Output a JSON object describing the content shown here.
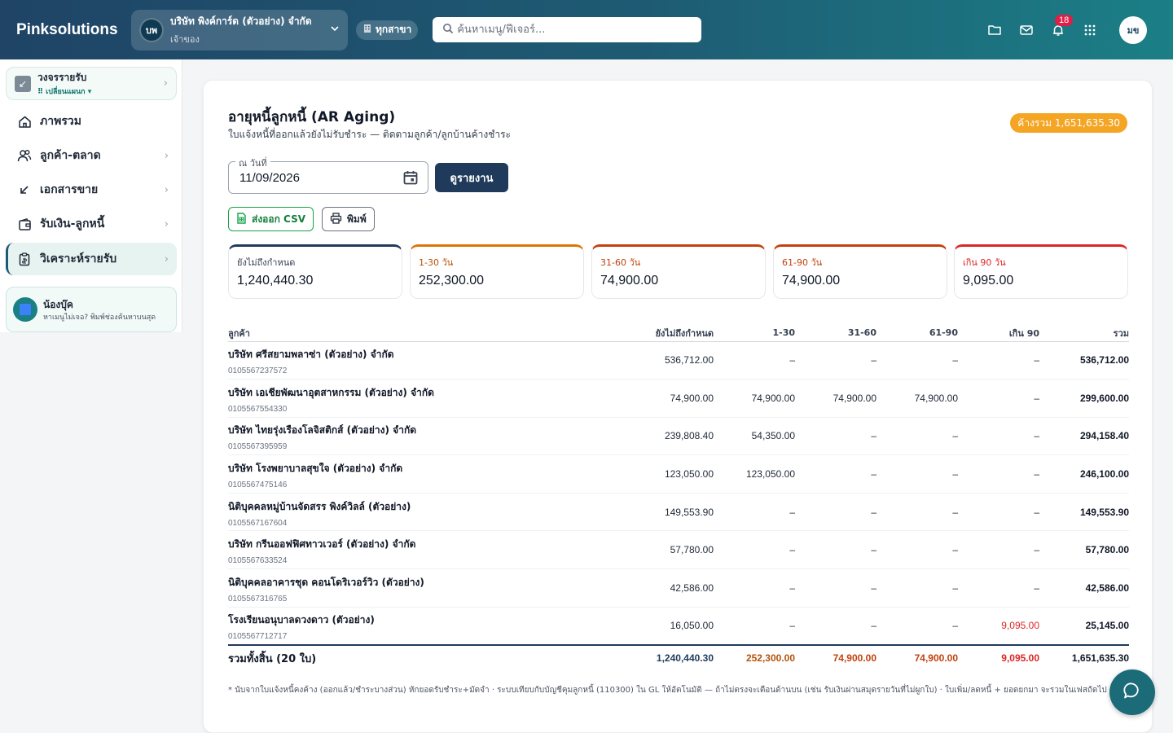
{
  "header": {
    "brand": "Pinksolutions",
    "company": {
      "initials": "บพ",
      "name": "บริษัท พิงค์การ์ด (ตัวอย่าง) จำกัด",
      "role": "เจ้าของ"
    },
    "branch_label": "ทุกสาขา",
    "search_placeholder": "ค้นหาเมนู/ฟีเจอร์...",
    "notification_count": "18",
    "user_initials": "มข"
  },
  "sidebar": {
    "ledger": {
      "title": "วงจรรายรับ",
      "subtitle": "⠿ เปลี่ยนแผนก ▾"
    },
    "items": [
      {
        "label": "ภาพรวม",
        "icon": "home-icon",
        "has_chevron": false
      },
      {
        "label": "ลูกค้า-ตลาด",
        "icon": "users-icon",
        "has_chevron": true
      },
      {
        "label": "เอกสารขาย",
        "icon": "arrow-down-left-icon",
        "has_chevron": true
      },
      {
        "label": "รับเงิน-ลูกหนี้",
        "icon": "wallet-icon",
        "has_chevron": true
      },
      {
        "label": "วิเคราะห์รายรับ",
        "icon": "report-icon",
        "has_chevron": true,
        "active": true
      }
    ],
    "helper": {
      "title": "น้องบุ๊ค",
      "text": "หาเมนูไม่เจอ? พิมพ์ช่องค้นหาบนสุด"
    }
  },
  "report": {
    "title": "อายุหนี้ลูกหนี้ (AR Aging)",
    "subtitle": "ใบแจ้งหนี้ที่ออกแล้วยังไม่รับชำระ — ติดตามลูกค้า/ลูกบ้านค้างชำระ",
    "total_pill": "ค้างรวม 1,651,635.30",
    "date_label": "ณ วันที่",
    "date_value": "11/09/2026",
    "run_button": "ดูรายงาน",
    "export_csv": "ส่งออก CSV",
    "print": "พิมพ์",
    "buckets": [
      {
        "label": "ยังไม่ถึงกำหนด",
        "value": "1,240,440.30",
        "color": "#1f3a5a",
        "label_color": "#374151"
      },
      {
        "label": "1-30 วัน",
        "value": "252,300.00",
        "color": "#d97706",
        "label_color": "#b45309"
      },
      {
        "label": "31-60 วัน",
        "value": "74,900.00",
        "color": "#c2410c",
        "label_color": "#c2410c"
      },
      {
        "label": "61-90 วัน",
        "value": "74,900.00",
        "color": "#c2410c",
        "label_color": "#c2410c"
      },
      {
        "label": "เกิน 90 วัน",
        "value": "9,095.00",
        "color": "#dc2626",
        "label_color": "#dc2626"
      }
    ],
    "columns": [
      "ลูกค้า",
      "ยังไม่ถึงกำหนด",
      "1-30",
      "31-60",
      "61-90",
      "เกิน 90",
      "รวม"
    ],
    "rows": [
      {
        "name": "บริษัท ศรีสยามพลาซ่า (ตัวอย่าง) จำกัด",
        "tax_id": "0105567237572",
        "current": "536,712.00",
        "d30": "–",
        "d60": "–",
        "d90": "–",
        "over90": "–",
        "total": "536,712.00"
      },
      {
        "name": "บริษัท เอเชียพัฒนาอุตสาหกรรม (ตัวอย่าง) จำกัด",
        "tax_id": "0105567554330",
        "current": "74,900.00",
        "d30": "74,900.00",
        "d60": "74,900.00",
        "d90": "74,900.00",
        "over90": "–",
        "total": "299,600.00"
      },
      {
        "name": "บริษัท ไทยรุ่งเรืองโลจิสติกส์ (ตัวอย่าง) จำกัด",
        "tax_id": "0105567395959",
        "current": "239,808.40",
        "d30": "54,350.00",
        "d60": "–",
        "d90": "–",
        "over90": "–",
        "total": "294,158.40"
      },
      {
        "name": "บริษัท โรงพยาบาลสุขใจ (ตัวอย่าง) จำกัด",
        "tax_id": "0105567475146",
        "current": "123,050.00",
        "d30": "123,050.00",
        "d60": "–",
        "d90": "–",
        "over90": "–",
        "total": "246,100.00"
      },
      {
        "name": "นิติบุคคลหมู่บ้านจัดสรร พิงค์วิลล์ (ตัวอย่าง)",
        "tax_id": "0105567167604",
        "current": "149,553.90",
        "d30": "–",
        "d60": "–",
        "d90": "–",
        "over90": "–",
        "total": "149,553.90"
      },
      {
        "name": "บริษัท กรีนออฟฟิศทาวเวอร์ (ตัวอย่าง) จำกัด",
        "tax_id": "0105567633524",
        "current": "57,780.00",
        "d30": "–",
        "d60": "–",
        "d90": "–",
        "over90": "–",
        "total": "57,780.00"
      },
      {
        "name": "นิติบุคคลอาคารชุด คอนโดริเวอร์วิว (ตัวอย่าง)",
        "tax_id": "0105567316765",
        "current": "42,586.00",
        "d30": "–",
        "d60": "–",
        "d90": "–",
        "over90": "–",
        "total": "42,586.00"
      },
      {
        "name": "โรงเรียนอนุบาลดวงดาว (ตัวอย่าง)",
        "tax_id": "0105567712717",
        "current": "16,050.00",
        "d30": "–",
        "d60": "–",
        "d90": "–",
        "over90": "9,095.00",
        "total": "25,145.00"
      }
    ],
    "totals": {
      "label": "รวมทั้งสิ้น (20 ใบ)",
      "current": "1,240,440.30",
      "d30": "252,300.00",
      "d60": "74,900.00",
      "d90": "74,900.00",
      "over90": "9,095.00",
      "total": "1,651,635.30"
    },
    "footnote": "* นับจากใบแจ้งหนี้คงค้าง (ออกแล้ว/ชำระบางส่วน) หักยอดรับชำระ+มัดจำ · ระบบเทียบกับบัญชีคุมลูกหนี้ (110300) ใน GL ให้อัตโนมัติ — ถ้าไม่ตรงจะเตือนด้านบน (เช่น รับเงินผ่านสมุดรายวันที่ไม่ผูกใบ) · ใบเพิ่ม/ลดหนี้ + ยอดยกมา จะรวมในเฟสถัดไป",
    "total_colors": {
      "current": "#1f3a5a",
      "d30": "#b45309",
      "d60": "#c2410c",
      "d90": "#c2410c",
      "over90": "#dc2626",
      "total": "#111827"
    }
  }
}
